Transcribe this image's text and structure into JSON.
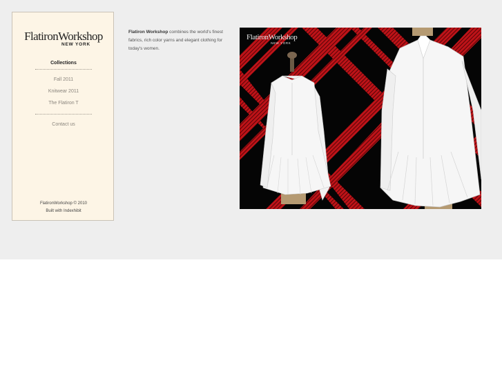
{
  "brand": {
    "logo_main": "FlatironWorkshop",
    "logo_sub": "NEW YORK"
  },
  "nav": {
    "heading": "Collections",
    "items": [
      {
        "label": "Fall 2011"
      },
      {
        "label": "Knitwear 2011"
      },
      {
        "label": "The Flatiron T"
      }
    ],
    "contact": "Contact us"
  },
  "footer": {
    "copyright": "FlatironWorkshop © 2010",
    "built_with": "Built with Indexhibit"
  },
  "intro": {
    "brand_name": "Flatiron Workshop",
    "text": " combines the world's finest fabrics, rich color yarns and elegant clothing for today's women."
  },
  "hero": {
    "logo_main": "FlatironWorkshop",
    "logo_sub": "NEW YORK",
    "colors": {
      "background": "#050505",
      "plaid": "#c8141a",
      "shirt": "#f4f4f4"
    }
  }
}
